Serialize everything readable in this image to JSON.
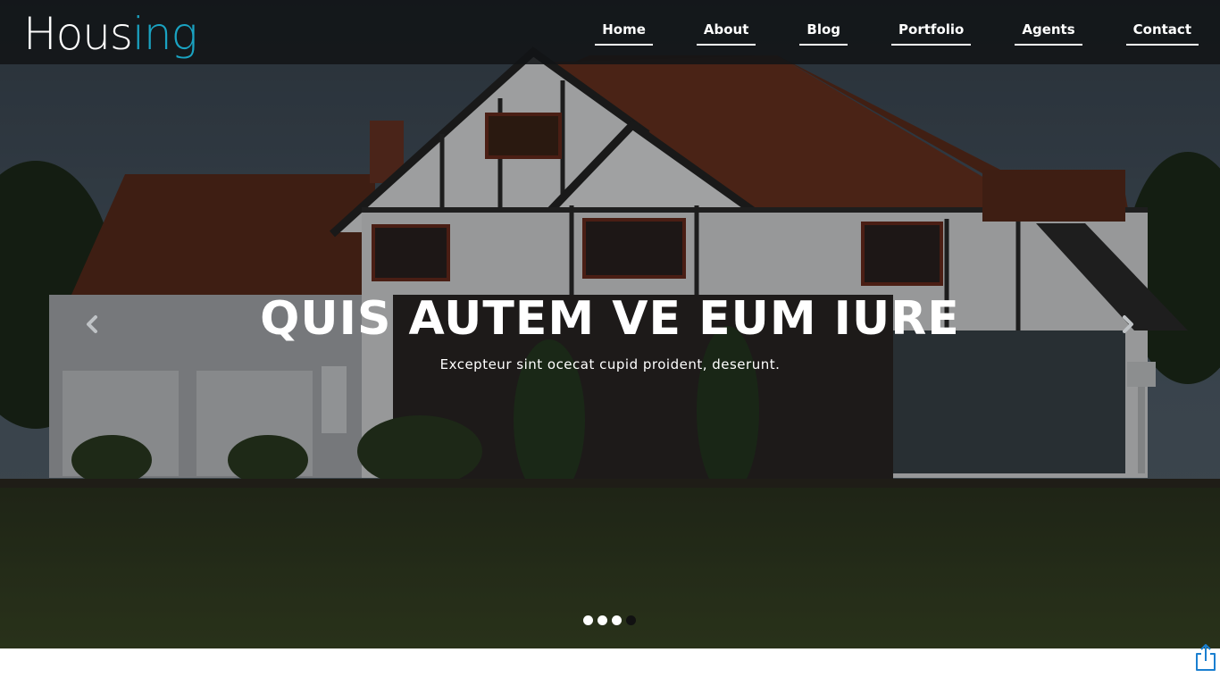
{
  "brand": {
    "part1": "Hous",
    "part2": "ing",
    "accent_color": "#1aa3c2"
  },
  "nav": {
    "items": [
      {
        "label": "Home"
      },
      {
        "label": "About"
      },
      {
        "label": "Blog"
      },
      {
        "label": "Portfolio"
      },
      {
        "label": "Agents"
      },
      {
        "label": "Contact"
      }
    ]
  },
  "hero": {
    "title": "QUIS AUTEM VE EUM IURE",
    "subtitle": "Excepteur sint ocecat cupid proident, deserunt.",
    "prev_icon": "chevron-left-icon",
    "next_icon": "chevron-right-icon",
    "slide_count": 4,
    "active_slide": 4
  },
  "share_icon": "share-icon"
}
